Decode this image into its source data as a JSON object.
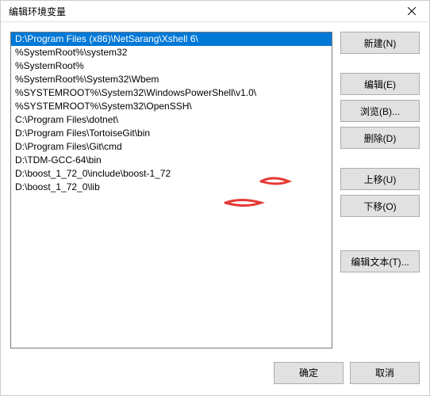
{
  "window": {
    "title": "编辑环境变量"
  },
  "list": {
    "selected_index": 0,
    "items": [
      "D:\\Program Files (x86)\\NetSarang\\Xshell 6\\",
      "%SystemRoot%\\system32",
      "%SystemRoot%",
      "%SystemRoot%\\System32\\Wbem",
      "%SYSTEMROOT%\\System32\\WindowsPowerShell\\v1.0\\",
      "%SYSTEMROOT%\\System32\\OpenSSH\\",
      "C:\\Program Files\\dotnet\\",
      "D:\\Program Files\\TortoiseGit\\bin",
      "D:\\Program Files\\Git\\cmd",
      "D:\\TDM-GCC-64\\bin",
      "D:\\boost_1_72_0\\include\\boost-1_72",
      "D:\\boost_1_72_0\\lib"
    ]
  },
  "buttons": {
    "new": "新建(N)",
    "edit": "编辑(E)",
    "browse": "浏览(B)...",
    "delete": "删除(D)",
    "moveup": "上移(U)",
    "movedown": "下移(O)",
    "edittext": "编辑文本(T)...",
    "ok": "确定",
    "cancel": "取消"
  },
  "annotation": {
    "color": "#e53935"
  }
}
